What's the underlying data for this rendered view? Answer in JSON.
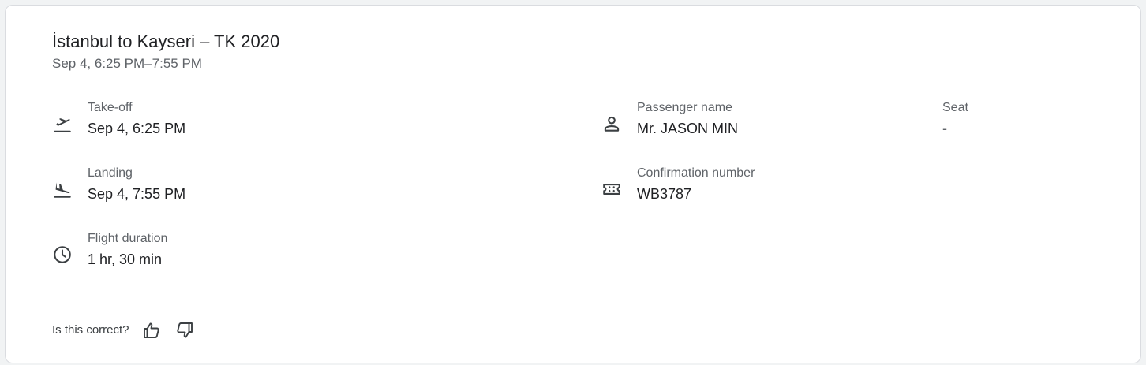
{
  "flight": {
    "title": "İstanbul to Kayseri – TK 2020",
    "subtitle": "Sep 4, 6:25 PM–7:55 PM"
  },
  "left_details": [
    {
      "icon": "takeoff-icon",
      "label": "Take-off",
      "value": "Sep 4, 6:25 PM"
    },
    {
      "icon": "landing-icon",
      "label": "Landing",
      "value": "Sep 4, 7:55 PM"
    },
    {
      "icon": "clock-icon",
      "label": "Flight duration",
      "value": "1 hr, 30 min"
    }
  ],
  "right_details": [
    {
      "icon": "person-icon",
      "label": "Passenger name",
      "value": "Mr. JASON MIN"
    },
    {
      "icon": "ticket-icon",
      "label": "Confirmation number",
      "value": "WB3787"
    }
  ],
  "seat": {
    "label": "Seat",
    "value": "-"
  },
  "feedback": {
    "question": "Is this correct?",
    "thumbs_up_icon": "thumbs-up-icon",
    "thumbs_down_icon": "thumbs-down-icon"
  },
  "colors": {
    "primary_text": "#202124",
    "secondary_text": "#5f6368",
    "border": "#dadce0",
    "divider": "#e8eaed"
  }
}
